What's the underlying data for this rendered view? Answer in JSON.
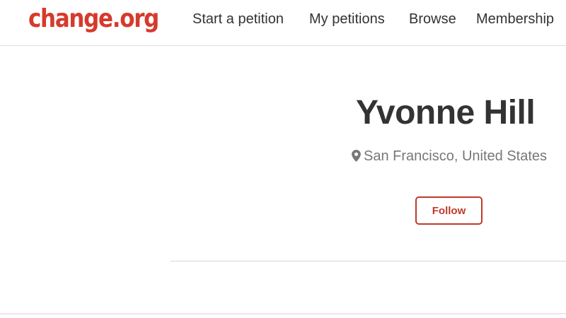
{
  "header": {
    "logo": "change.org",
    "nav": [
      {
        "label": "Start a petition"
      },
      {
        "label": "My petitions"
      },
      {
        "label": "Browse"
      },
      {
        "label": "Membership"
      }
    ]
  },
  "profile": {
    "name": "Yvonne Hill",
    "location": "San Francisco, United States",
    "location_icon": "map-pin-icon",
    "follow_label": "Follow"
  },
  "colors": {
    "brand": "#d63a2b",
    "follow_border": "#c0392b",
    "text": "#333333",
    "muted": "#777777"
  }
}
